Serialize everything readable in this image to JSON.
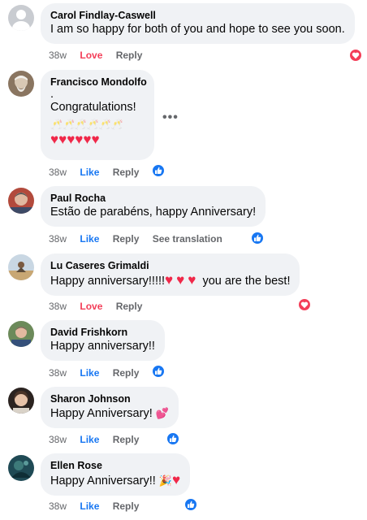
{
  "comments": [
    {
      "name": "Carol Findlay-Caswell",
      "lines": [
        "I am so happy for both of you and hope to see you soon."
      ],
      "time": "38w",
      "reaction": "Love",
      "reply": "Reply",
      "badge": "love-icon"
    },
    {
      "name": "Francisco Mondolfo",
      "lines": [
        ".",
        "Congratulations!"
      ],
      "time": "38w",
      "reaction": "Like",
      "reply": "Reply",
      "badge": "like-icon"
    },
    {
      "name": "Paul Rocha",
      "lines": [
        "Estão de parabéns, happy Anniversary!"
      ],
      "time": "38w",
      "reaction": "Like",
      "reply": "Reply",
      "extra": "See translation",
      "badge": "like-icon"
    },
    {
      "name": "Lu Caseres Grimaldi",
      "lines": [
        "Happy anniversary!!!!!",
        "you are the best!"
      ],
      "time": "38w",
      "reaction": "Love",
      "reply": "Reply",
      "badge": "love-icon"
    },
    {
      "name": "David Frishkorn",
      "lines": [
        "Happy anniversary!!"
      ],
      "time": "38w",
      "reaction": "Like",
      "reply": "Reply",
      "badge": "like-icon"
    },
    {
      "name": "Sharon Johnson",
      "lines": [
        "Happy Anniversary!"
      ],
      "time": "38w",
      "reaction": "Like",
      "reply": "Reply",
      "badge": "like-icon"
    },
    {
      "name": "Ellen Rose",
      "lines": [
        "Happy Anniversary!!"
      ],
      "time": "38w",
      "reaction": "Like",
      "reply": "Reply",
      "badge": "like-icon"
    }
  ],
  "emoji": {
    "toast": "🥂",
    "heart": "♥",
    "sparkling_heart": "💕",
    "party": "🎉"
  },
  "colors": {
    "like": "#1877f2",
    "love": "#f33e58",
    "meta": "#65676b",
    "bubble": "#f0f2f5"
  }
}
